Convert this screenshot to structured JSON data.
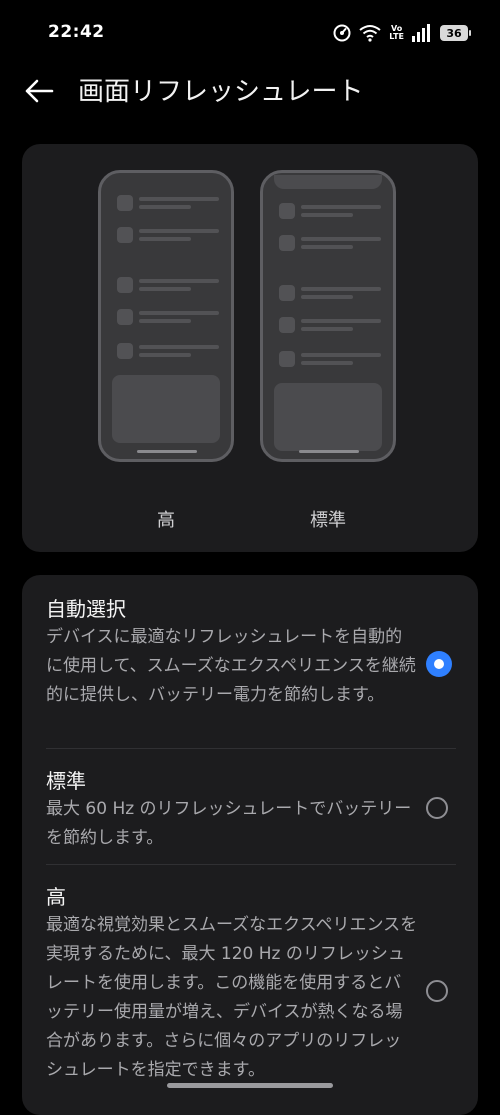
{
  "status_bar": {
    "time": "22:42",
    "icons": [
      "data-saver-icon",
      "wifi-icon",
      "volte-icon",
      "signal-icon",
      "battery-icon"
    ],
    "volte_top": "Vo",
    "volte_bottom": "LTE",
    "battery": "36"
  },
  "header": {
    "back_icon": "arrow-left-icon",
    "title": "画面リフレッシュレート"
  },
  "preview": {
    "high_label": "高",
    "standard_label": "標準"
  },
  "options": [
    {
      "title": "自動選択",
      "description": "デバイスに最適なリフレッシュレートを自動的に使用して、スムーズなエクスペリエンスを継続的に提供し、バッテリー電力を節約します。",
      "selected": true
    },
    {
      "title": "標準",
      "description": "最大 60 Hz のリフレッシュレートでバッテリーを節約します。",
      "selected": false
    },
    {
      "title": "高",
      "description": "最適な視覚効果とスムーズなエクスペリエンスを実現するために、最大 120 Hz のリフレッシュレートを使用します。この機能を使用するとバッテリー使用量が増え、デバイスが熱くなる場合があります。さらに個々のアプリのリフレッシュレートを指定できます。",
      "selected": false
    }
  ],
  "colors": {
    "accent": "#2f80ff",
    "card_bg": "#1c1c1e",
    "background": "#000000"
  }
}
